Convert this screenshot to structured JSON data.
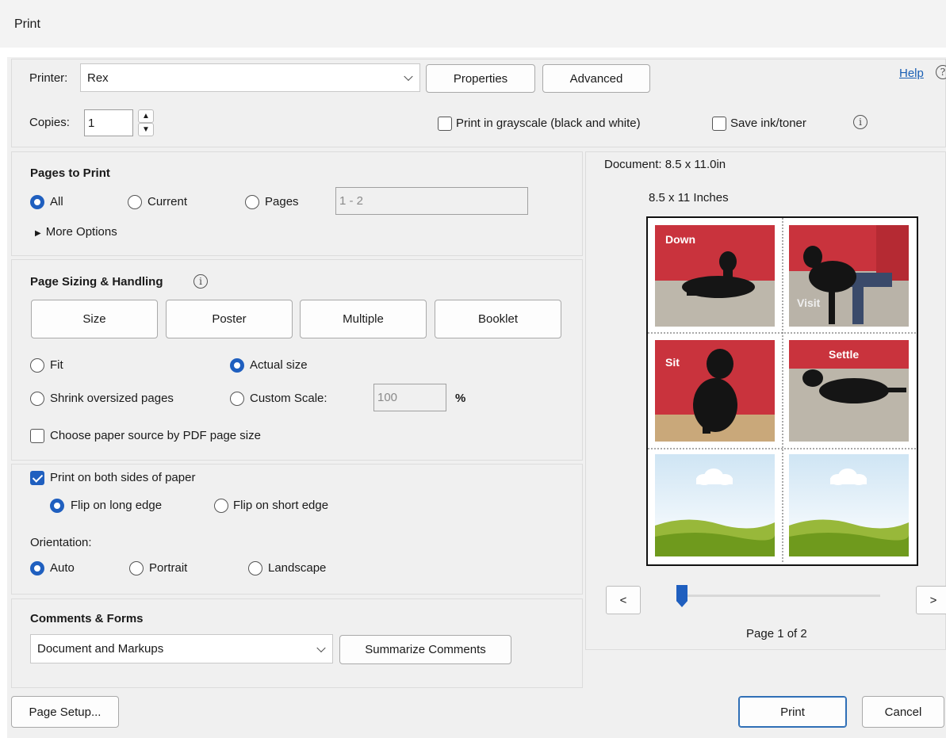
{
  "window": {
    "title": "Print"
  },
  "printer": {
    "label": "Printer:",
    "value": "Rex",
    "properties_button": "Properties",
    "advanced_button": "Advanced",
    "help_link": "Help"
  },
  "copies": {
    "label": "Copies:",
    "value": "1"
  },
  "options": {
    "grayscale_label": "Print in grayscale (black and white)",
    "grayscale_checked": false,
    "save_ink_label": "Save ink/toner",
    "save_ink_checked": false
  },
  "pages_to_print": {
    "heading": "Pages to Print",
    "all_label": "All",
    "current_label": "Current",
    "pages_label": "Pages",
    "selected": "All",
    "pages_range": "1 - 2",
    "more_options": "More Options"
  },
  "sizing": {
    "heading": "Page Sizing & Handling",
    "tabs": [
      "Size",
      "Poster",
      "Multiple",
      "Booklet"
    ],
    "fit_label": "Fit",
    "actual_label": "Actual size",
    "shrink_label": "Shrink oversized pages",
    "custom_label": "Custom Scale:",
    "custom_value": "100",
    "percent": "%",
    "selected": "Actual size",
    "paper_source_label": "Choose paper source by PDF page size",
    "paper_source_checked": false
  },
  "duplex": {
    "both_sides_label": "Print on both sides of paper",
    "both_sides_checked": true,
    "long_edge_label": "Flip on long edge",
    "short_edge_label": "Flip on short edge",
    "selected_flip": "long",
    "orientation_heading": "Orientation:",
    "auto_label": "Auto",
    "portrait_label": "Portrait",
    "landscape_label": "Landscape",
    "selected_orientation": "Auto"
  },
  "comments": {
    "heading": "Comments & Forms",
    "value": "Document and Markups",
    "summarize_button": "Summarize Comments"
  },
  "preview": {
    "document_size": "Document: 8.5 x 11.0in",
    "paper_size": "8.5 x 11 Inches",
    "tile_labels": [
      "Down",
      "Visit",
      "Sit",
      "Settle"
    ],
    "prev_button": "<",
    "next_button": ">",
    "page_indicator": "Page 1 of 2",
    "current_page_fraction": 0.0
  },
  "footer": {
    "page_setup_button": "Page Setup...",
    "print_button": "Print",
    "cancel_button": "Cancel"
  },
  "colors": {
    "accent": "#1f5fbf",
    "tile_red": "#c9333d",
    "sky": "#d7eaf6",
    "grass": "#7ea526"
  }
}
